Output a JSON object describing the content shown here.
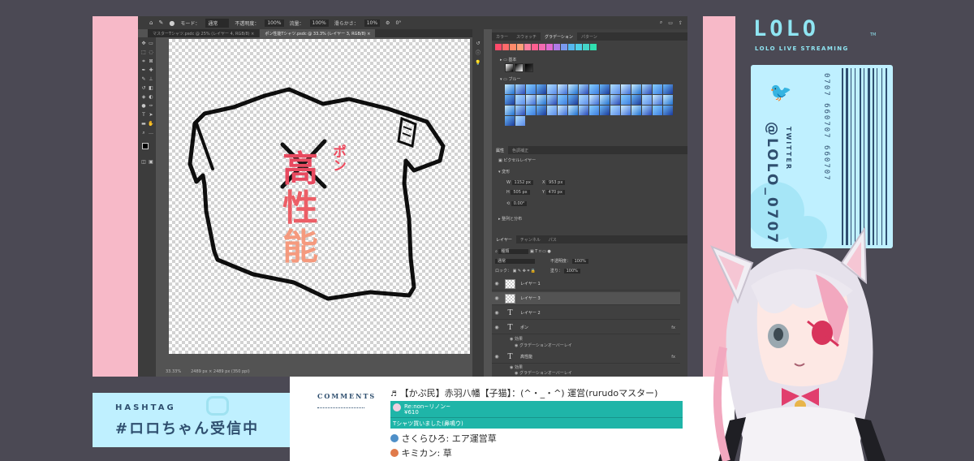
{
  "photoshop": {
    "options_bar": [
      "モード：",
      "通常",
      "不透明度：",
      "100%",
      "流量：",
      "100%",
      "滑らかさ：",
      "10%",
      "0°"
    ],
    "doc_tabs": [
      {
        "label": "マスターTシャツ.psdc @ 25% (レイヤー 4, RGB/8)",
        "active": false
      },
      {
        "label": "ポン性能Tシャツ.psdc @ 33.3% (レイヤー 3, RGB/8)",
        "active": true
      }
    ],
    "status": {
      "zoom": "33.33%",
      "doc_info": "2489 px × 2489 px (350 ppi)"
    },
    "canvas_text": {
      "pon": "ポン",
      "kou": "高",
      "sei": "性",
      "nou": "能"
    },
    "panels": {
      "top_tabs": [
        "カラー",
        "スウォッチ",
        "グラデーション",
        "パターン"
      ],
      "active_top_tab": "グラデーション",
      "gradient_groups": [
        "基本",
        "ブルー"
      ],
      "props_tabs": [
        "属性",
        "色調補正"
      ],
      "props_type": "ピクセルレイヤー",
      "transform_label": "変形",
      "transform": {
        "w": "1152 px",
        "x": "953 px",
        "h": "505 px",
        "y": "470 px",
        "angle": "0.00°"
      },
      "align_label": "整列と分布",
      "layers_tabs": [
        "レイヤー",
        "チャンネル",
        "パス"
      ],
      "layers_filter": "種類",
      "blend_mode": "通常",
      "opacity_label": "不透明度：",
      "opacity": "100%",
      "lock_label": "ロック：",
      "fill_label": "塗り：",
      "fill": "100%",
      "layers": [
        {
          "name": "レイヤー 1",
          "kind": "pixel",
          "selected": false
        },
        {
          "name": "レイヤー 3",
          "kind": "pixel",
          "selected": true
        },
        {
          "name": "レイヤー 2",
          "kind": "text",
          "selected": false
        },
        {
          "name": "ポン",
          "kind": "text",
          "selected": false,
          "fx": "fx",
          "effects_label": "効果",
          "effect": "グラデーションオーバーレイ"
        },
        {
          "name": "高性能",
          "kind": "text",
          "selected": false,
          "fx": "fx",
          "effects_label": "効果",
          "effect": "グラデーションオーバーレイ"
        }
      ]
    }
  },
  "overlay": {
    "logo": "LOLO",
    "logo_tm": "TM",
    "logo_sub": "LOLO LIVE STREAMING",
    "twitter_label": "TWITTER",
    "twitter_handle": "@LOLO_0707",
    "barcode_digits": "0707 660707 660707",
    "hashtag_label": "HASHTAG",
    "hashtag": "#ロロちゃん受信中",
    "comments_label": "COMMENTS"
  },
  "comments": [
    {
      "type": "text",
      "author": "【かぷ民】赤羽八幡【子猫】：(^・_・^) 運営(rurudoマスター)",
      "text": ""
    },
    {
      "type": "superchat",
      "author": "Re:non~リノン~",
      "amount": "¥610",
      "text": "Tシャツ買いました(鼻鳴ウ)"
    },
    {
      "type": "text",
      "author": "さくらひろ",
      "text": "エア運営草"
    },
    {
      "type": "text",
      "author": "キミカン",
      "text": "草"
    }
  ],
  "colors": {
    "pink": "#f7b9c8",
    "cyan": "#bff0ff",
    "navy": "#2f4f6f",
    "superchat": "#1fb5a8"
  }
}
